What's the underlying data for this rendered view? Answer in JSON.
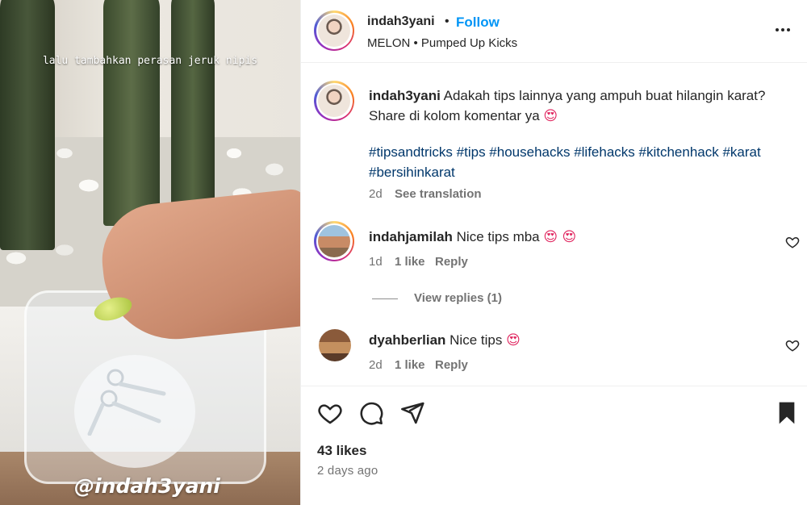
{
  "media": {
    "overlay_caption": "lalu tambahkan perasan jeruk nipis",
    "watermark": "@indah3yani"
  },
  "post_header": {
    "username": "indah3yani",
    "separator": "•",
    "follow_label": "Follow",
    "audio": "MELON • Pumped Up Kicks",
    "more_icon": "more-options-icon"
  },
  "caption": {
    "username": "indah3yani",
    "text_line1": "Adakah tips lainnya yang ampuh buat hilangin karat?",
    "text_line2": "Share di kolom komentar ya",
    "emoji": "😍",
    "hashtags_line1": "#tipsandtricks #tips #househacks #lifehacks #kitchenhack #karat",
    "hashtags_line2": "#bersihinkarat",
    "time": "2d",
    "see_translation": "See translation"
  },
  "comments": [
    {
      "username": "indahjamilah",
      "text": "Nice tips mba",
      "emoji": "😍 😍",
      "time": "1d",
      "likes": "1 like",
      "reply": "Reply",
      "view_replies": "View replies (1)"
    },
    {
      "username": "dyahberlian",
      "text": "Nice tips",
      "emoji": "😍",
      "time": "2d",
      "likes": "1 like",
      "reply": "Reply"
    }
  ],
  "actions": {
    "likes": "43 likes",
    "date": "2 days ago",
    "icons": [
      "heart-icon",
      "comment-icon",
      "share-icon",
      "bookmark-icon"
    ]
  }
}
